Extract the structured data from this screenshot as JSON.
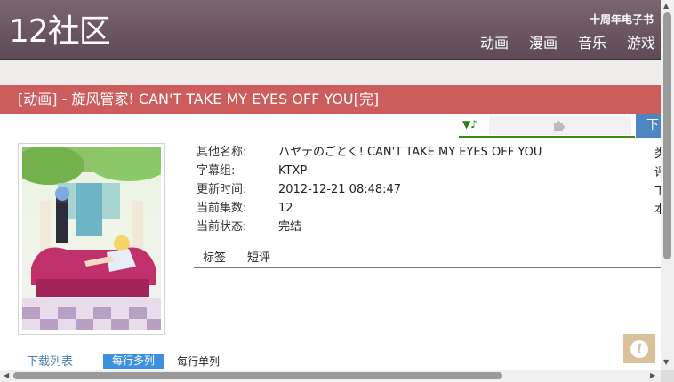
{
  "site": {
    "logo": "12社区",
    "promo": "十周年电子书"
  },
  "nav": [
    "动画",
    "漫画",
    "音乐",
    "游戏"
  ],
  "title": "[动画] - 旋风管家! CAN'T TAKE MY EYES OFF YOU[完]",
  "player": {
    "control_label": "▼♪",
    "plugin_icon": "puzzle-piece-icon"
  },
  "download_button": "下载",
  "info": {
    "rows": [
      {
        "label": "其他名称:",
        "value": "ハヤテのごとく! CAN'T TAKE MY EYES OFF YOU"
      },
      {
        "label": "字幕组:",
        "value": "KTXP"
      },
      {
        "label": "更新时间:",
        "value": "2012-12-21 08:48:47"
      },
      {
        "label": "当前集数:",
        "value": "12"
      },
      {
        "label": "当前状态:",
        "value": "完结"
      }
    ],
    "right_clipped": [
      "类",
      "评",
      "下",
      "本"
    ]
  },
  "tabs": [
    "标签",
    "短评"
  ],
  "download_list": {
    "label": "下载列表",
    "mode_active": "每行多列",
    "mode_inactive": "每行单列"
  },
  "colors": {
    "header": "#6a5560",
    "title_bar": "#cd5c5c",
    "accent_blue": "#3d8fe0",
    "player_green": "#3a8a1c"
  }
}
